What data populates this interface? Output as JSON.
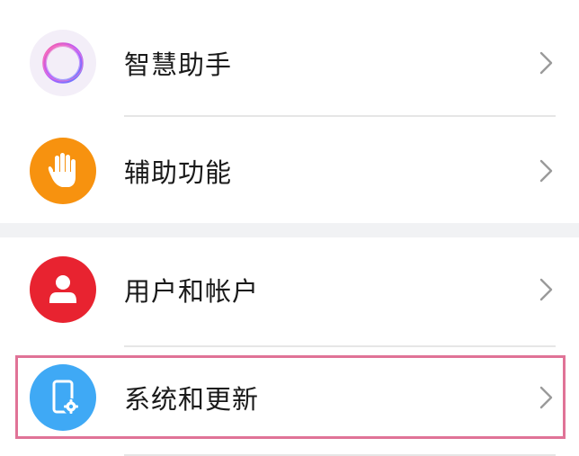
{
  "settings": {
    "items": [
      {
        "label": "智慧助手",
        "icon": "assistant-ring-icon",
        "color": "#f5eef9"
      },
      {
        "label": "辅助功能",
        "icon": "hand-icon",
        "color": "#f7920f"
      },
      {
        "label": "用户和帐户",
        "icon": "user-icon",
        "color": "#e82330"
      },
      {
        "label": "系统和更新",
        "icon": "phone-gear-icon",
        "color": "#3fa9f5"
      }
    ],
    "highlight_color": "#e07397",
    "separator_color": "#f1f2f4"
  }
}
